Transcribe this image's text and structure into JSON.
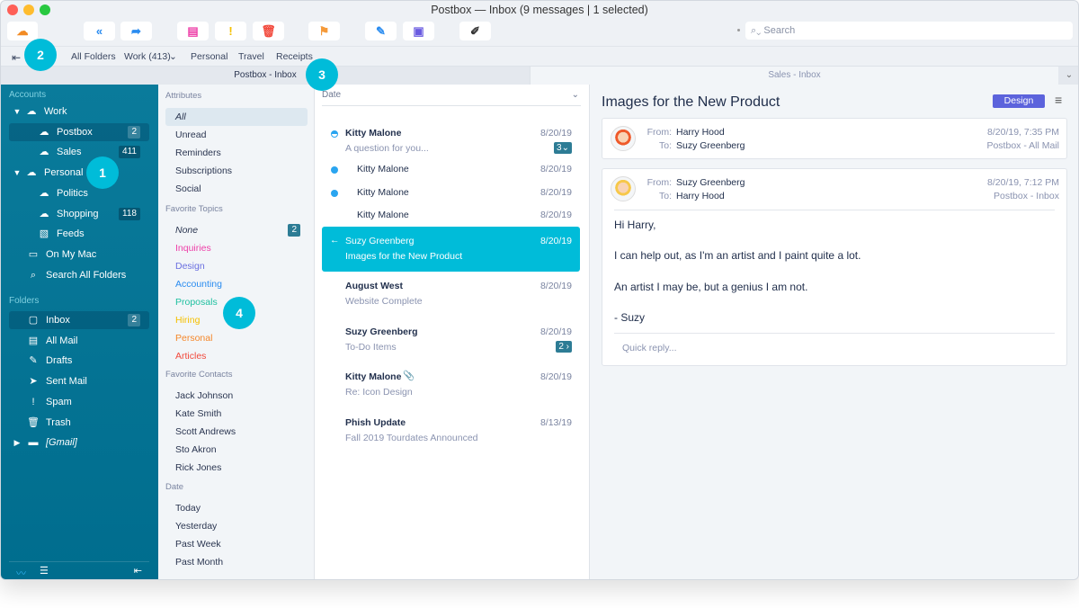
{
  "window": {
    "title": "Postbox — Inbox (9 messages | 1 selected)"
  },
  "toolbar": {
    "buttons": [
      {
        "name": "get-mail",
        "icon": "cloud-download-icon",
        "color": "#f28b24"
      },
      {
        "name": "reply-all",
        "icon": "reply-all-icon",
        "color": "#2a8cf0"
      },
      {
        "name": "forward",
        "icon": "forward-icon",
        "color": "#2a8cf0"
      },
      {
        "name": "archive",
        "icon": "archive-icon",
        "color": "#ee3fa8"
      },
      {
        "name": "junk",
        "icon": "exclamation-icon",
        "color": "#f5c000"
      },
      {
        "name": "delete",
        "icon": "trash-icon",
        "color": "#f2493c"
      },
      {
        "name": "flag",
        "icon": "flag-icon",
        "color": "#f59a3a"
      },
      {
        "name": "compose",
        "icon": "pencil-icon",
        "color": "#2a8cf0"
      },
      {
        "name": "contacts",
        "icon": "address-book-icon",
        "color": "#6a5be0"
      },
      {
        "name": "customize",
        "icon": "brush-icon",
        "color": "#333333"
      }
    ],
    "search_placeholder": "Search"
  },
  "favorites_bar": {
    "items": [
      "All Folders",
      "Work (413)",
      "Personal",
      "Travel",
      "Receipts"
    ]
  },
  "tabs": [
    {
      "label": "Postbox - Inbox",
      "active": true
    },
    {
      "label": "Sales - Inbox",
      "active": false
    }
  ],
  "callouts": [
    "1",
    "2",
    "3",
    "4"
  ],
  "sidebar": {
    "accounts_heading": "Accounts",
    "accounts": [
      {
        "label": "Work",
        "icon": "cloud-icon",
        "expanded": true
      },
      {
        "label": "Postbox",
        "icon": "cloud-icon",
        "badge": "2",
        "selected": true
      },
      {
        "label": "Sales",
        "icon": "cloud-icon",
        "badge": "411"
      },
      {
        "label": "Personal",
        "icon": "cloud-icon",
        "expanded": true
      },
      {
        "label": "Politics",
        "icon": "cloud-icon"
      },
      {
        "label": "Shopping",
        "icon": "cloud-icon",
        "badge": "118"
      },
      {
        "label": "Feeds",
        "icon": "rss-icon"
      },
      {
        "label": "On My Mac",
        "icon": "monitor-icon"
      },
      {
        "label": "Search All Folders",
        "icon": "search-icon"
      }
    ],
    "folders_heading": "Folders",
    "folders": [
      {
        "label": "Inbox",
        "icon": "inbox-icon",
        "badge": "2",
        "selected": true
      },
      {
        "label": "All Mail",
        "icon": "archive-icon"
      },
      {
        "label": "Drafts",
        "icon": "pencil-icon"
      },
      {
        "label": "Sent Mail",
        "icon": "paper-plane-icon"
      },
      {
        "label": "Spam",
        "icon": "exclamation-icon"
      },
      {
        "label": "Trash",
        "icon": "trash-icon"
      },
      {
        "label": "[Gmail]",
        "icon": "folder-icon",
        "collapsed": true
      }
    ]
  },
  "filters": {
    "attributes_heading": "Attributes",
    "attributes": [
      "All",
      "Unread",
      "Reminders",
      "Subscriptions",
      "Social"
    ],
    "topics_heading": "Favorite Topics",
    "topics": [
      {
        "label": "None",
        "color": "#2a3550",
        "badge": "2"
      },
      {
        "label": "Inquiries",
        "color": "#ee3fa8"
      },
      {
        "label": "Design",
        "color": "#6a6fe0"
      },
      {
        "label": "Accounting",
        "color": "#2a8cf0"
      },
      {
        "label": "Proposals",
        "color": "#1fc0a0"
      },
      {
        "label": "Hiring",
        "color": "#f5c000"
      },
      {
        "label": "Personal",
        "color": "#f5872a"
      },
      {
        "label": "Articles",
        "color": "#f2493c"
      }
    ],
    "contacts_heading": "Favorite Contacts",
    "contacts": [
      "Jack Johnson",
      "Kate Smith",
      "Scott Andrews",
      "Sto Akron",
      "Rick Jones"
    ],
    "date_heading": "Date",
    "dates": [
      "Today",
      "Yesterday",
      "Past Week",
      "Past Month"
    ]
  },
  "message_list": {
    "sort_label": "Date",
    "thread": {
      "from": "Kitty Malone",
      "date": "8/20/19",
      "subject": "A question for you...",
      "count": "3",
      "children": [
        {
          "from": "Kitty Malone",
          "date": "8/20/19",
          "unread": true
        },
        {
          "from": "Kitty Malone",
          "date": "8/20/19",
          "unread": true
        },
        {
          "from": "Kitty Malone",
          "date": "8/20/19",
          "unread": false
        }
      ]
    },
    "messages": [
      {
        "from": "Suzy Greenberg",
        "date": "8/20/19",
        "subject": "Images for the New Product",
        "selected": true,
        "replied": true
      },
      {
        "from": "August West",
        "date": "8/20/19",
        "subject": "Website Complete"
      },
      {
        "from": "Suzy Greenberg",
        "date": "8/20/19",
        "subject": "To-Do Items",
        "count": "2"
      },
      {
        "from": "Kitty Malone",
        "date": "8/20/19",
        "subject": "Re: Icon Design",
        "attachment": true
      },
      {
        "from": "Phish Update",
        "date": "8/13/19",
        "subject": "Fall 2019 Tourdates Announced"
      }
    ]
  },
  "reader": {
    "title": "Images for the New Product",
    "tag": {
      "label": "Design",
      "color": "#5c63dc"
    },
    "from_label": "From:",
    "to_label": "To:",
    "messages": [
      {
        "from": "Harry Hood",
        "to": "Suzy Greenberg",
        "date": "8/20/19, 7:35 PM",
        "folder": "Postbox - All Mail"
      },
      {
        "from": "Suzy Greenberg",
        "to": "Harry Hood",
        "date": "8/20/19, 7:12 PM",
        "folder": "Postbox - Inbox",
        "body": [
          "Hi Harry,",
          "I can help out, as I'm an artist and I paint quite a lot.",
          "An artist I may be, but a genius I am not.",
          "- Suzy"
        ]
      }
    ],
    "quick_reply_placeholder": "Quick reply..."
  }
}
